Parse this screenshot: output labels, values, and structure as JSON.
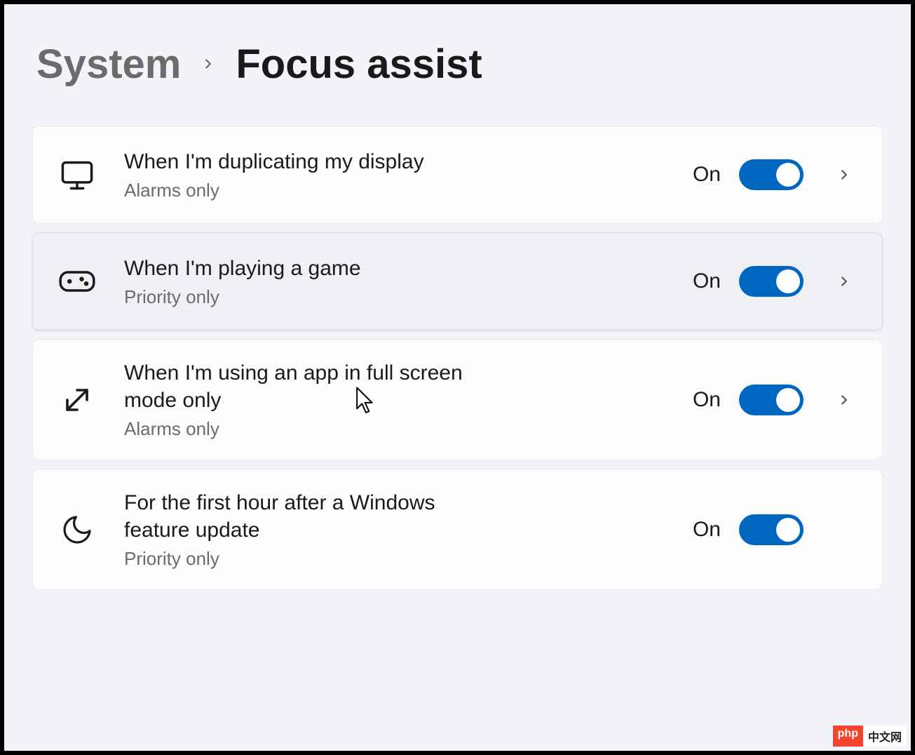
{
  "breadcrumb": {
    "parent": "System",
    "current": "Focus assist"
  },
  "rows": [
    {
      "icon": "monitor-icon",
      "title": "When I'm duplicating my display",
      "subtitle": "Alarms only",
      "status": "On",
      "expandable": true
    },
    {
      "icon": "gamepad-icon",
      "title": "When I'm playing a game",
      "subtitle": "Priority only",
      "status": "On",
      "expandable": true,
      "hover": true
    },
    {
      "icon": "fullscreen-arrow-icon",
      "title": "When I'm using an app in full screen mode only",
      "subtitle": "Alarms only",
      "status": "On",
      "expandable": true
    },
    {
      "icon": "moon-icon",
      "title": "For the first hour after a Windows feature update",
      "subtitle": "Priority only",
      "status": "On",
      "expandable": false
    }
  ],
  "colors": {
    "accent": "#0067c0",
    "page_bg": "#f3f4f9",
    "card_bg": "#fcfcfd",
    "card_hover_bg": "#eef0f4",
    "text_primary": "#1a1a1a",
    "text_secondary": "#6b6b6b"
  },
  "watermark": {
    "left": "php",
    "right": "中文网"
  }
}
